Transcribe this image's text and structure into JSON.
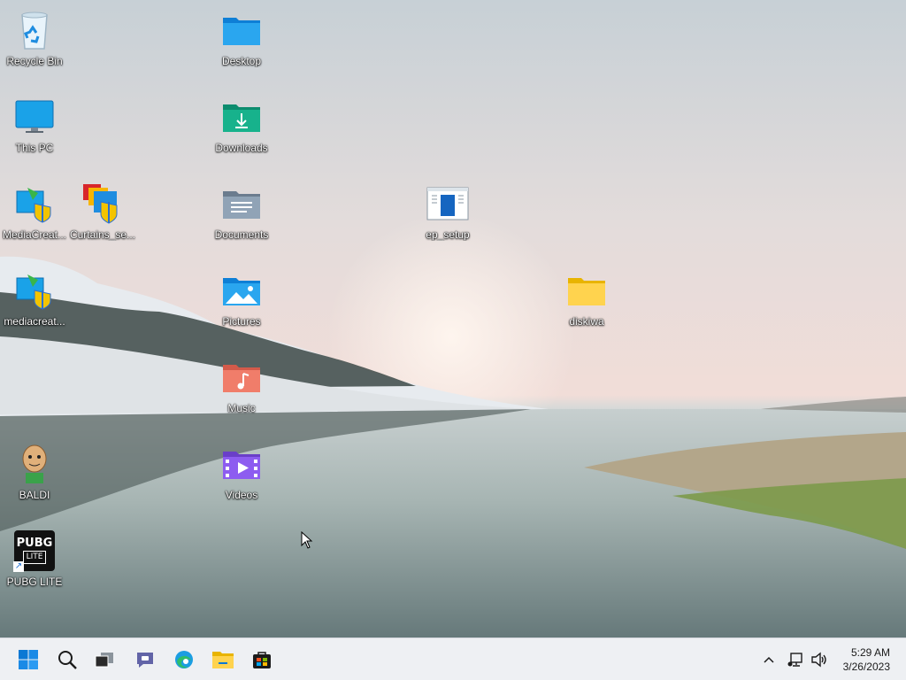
{
  "desktop": {
    "icons": [
      {
        "label": "Recycle Bin",
        "icon": "recycle-bin-icon"
      },
      {
        "label": "This PC",
        "icon": "monitor-icon"
      },
      {
        "label": "MediaCreat...",
        "icon": "media-creation-tool-icon"
      },
      {
        "label": "Curtains_se...",
        "icon": "installer-shield-icon"
      },
      {
        "label": "mediacreat...",
        "icon": "media-creation-tool-icon"
      },
      {
        "label": "BALDI",
        "icon": "baldi-game-icon"
      },
      {
        "label": "PUBG LITE",
        "icon": "pubg-lite-icon"
      },
      {
        "label": "Desktop",
        "icon": "folder-blue-icon"
      },
      {
        "label": "Downloads",
        "icon": "downloads-folder-icon"
      },
      {
        "label": "Documents",
        "icon": "documents-folder-icon"
      },
      {
        "label": "Pictures",
        "icon": "pictures-folder-icon"
      },
      {
        "label": "Music",
        "icon": "music-folder-icon"
      },
      {
        "label": "Videos",
        "icon": "videos-folder-icon"
      },
      {
        "label": "ep_setup",
        "icon": "setup-window-icon"
      },
      {
        "label": "diskiwa",
        "icon": "folder-yellow-icon"
      }
    ]
  },
  "pubg_icon": {
    "line1": "PUBG",
    "line2": "LITE"
  },
  "taskbar": {
    "apps": [
      "start-icon",
      "search-icon",
      "task-view-icon",
      "teams-chat-icon",
      "edge-icon",
      "file-explorer-icon",
      "store-icon"
    ],
    "tray": [
      "chevron-up-icon",
      "network-icon",
      "volume-icon"
    ]
  },
  "clock": {
    "time": "5:29 AM",
    "date": "3/26/2023"
  },
  "colors": {
    "taskbar": "#eef0f3",
    "accent": "#0067c0"
  }
}
